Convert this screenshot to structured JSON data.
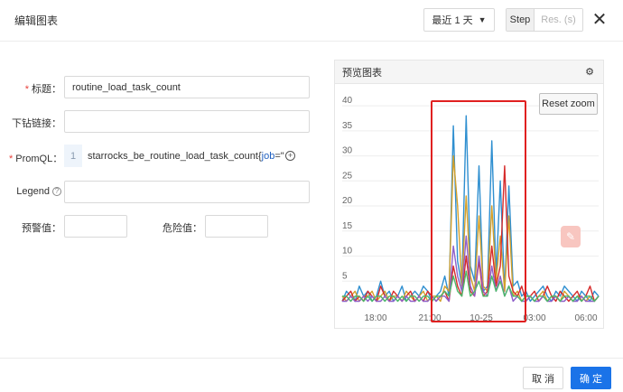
{
  "header": {
    "title": "编辑图表",
    "range_label": "最近 1 天",
    "step_label": "Step",
    "res_placeholder": "Res. (s)",
    "close_glyph": "✕"
  },
  "form": {
    "title_label": "标题：",
    "title_value": "routine_load_task_count",
    "drilldown_label": "下钻链接：",
    "drilldown_value": "",
    "promql_label": "PromQL：",
    "promql_line": "1",
    "promql_text": "starrocks_be_routine_load_task_count",
    "promql_brace": "{",
    "promql_key": "job",
    "promql_tail": "=\"",
    "legend_label": "Legend",
    "legend_value": "",
    "warn_label": "预警值：",
    "warn_value": "",
    "danger_label": "危险值：",
    "danger_value": ""
  },
  "preview": {
    "title": "预览图表",
    "reset_zoom": "Reset zoom"
  },
  "footer": {
    "cancel": "取 消",
    "ok": "确 定"
  },
  "icons": {
    "gear": "gear-icon",
    "help": "question-circle-icon",
    "add": "plus-circle-icon",
    "caret": "caret-down-icon",
    "float": "pencil-icon"
  },
  "colors": {
    "primary": "#1a73e8",
    "required": "#e8413a",
    "highlight": "#e02020"
  },
  "chart_data": {
    "type": "line",
    "x_ticks": [
      "18:00",
      "21:00",
      "10-25",
      "03:00",
      "06:00"
    ],
    "y_ticks": [
      5,
      10,
      15,
      20,
      25,
      30,
      35,
      40
    ],
    "ylim": [
      0,
      42
    ],
    "grid": true,
    "series": [
      {
        "color": "#2f8fd0",
        "values": [
          1,
          3,
          2,
          1,
          4,
          2,
          3,
          1,
          2,
          5,
          2,
          3,
          1,
          2,
          4,
          1,
          2,
          3,
          2,
          4,
          3,
          1,
          2,
          3,
          6,
          2,
          36,
          9,
          4,
          38,
          8,
          5,
          28,
          3,
          4,
          33,
          6,
          25,
          3,
          24,
          4,
          5,
          2,
          3,
          1,
          2,
          3,
          4,
          2,
          1,
          3,
          2,
          4,
          3,
          2,
          1,
          3,
          2,
          1,
          3,
          2
        ]
      },
      {
        "color": "#d4a02a",
        "values": [
          2,
          1,
          2,
          3,
          1,
          2,
          2,
          3,
          1,
          2,
          3,
          1,
          2,
          2,
          1,
          3,
          2,
          1,
          2,
          3,
          1,
          2,
          2,
          1,
          4,
          3,
          30,
          20,
          4,
          22,
          6,
          3,
          18,
          4,
          3,
          20,
          5,
          14,
          3,
          18,
          2,
          3,
          1,
          2,
          2,
          1,
          2,
          3,
          1,
          2,
          2,
          1,
          3,
          2,
          1,
          2,
          2,
          1,
          2,
          1,
          2
        ]
      },
      {
        "color": "#d62b2b",
        "values": [
          1,
          2,
          3,
          1,
          2,
          1,
          3,
          2,
          1,
          4,
          2,
          1,
          3,
          2,
          1,
          2,
          3,
          1,
          2,
          1,
          3,
          2,
          1,
          2,
          3,
          1,
          8,
          4,
          2,
          10,
          3,
          2,
          9,
          2,
          3,
          12,
          4,
          8,
          28,
          6,
          3,
          2,
          4,
          1,
          2,
          3,
          1,
          2,
          4,
          2,
          1,
          3,
          2,
          1,
          2,
          3,
          1,
          2,
          4,
          1,
          2
        ]
      },
      {
        "color": "#8e5fc9",
        "values": [
          1,
          1,
          2,
          1,
          1,
          2,
          1,
          2,
          1,
          1,
          2,
          1,
          1,
          2,
          1,
          2,
          1,
          1,
          2,
          1,
          1,
          2,
          1,
          2,
          2,
          1,
          12,
          6,
          3,
          14,
          4,
          2,
          10,
          3,
          2,
          8,
          3,
          6,
          2,
          4,
          1,
          2,
          1,
          1,
          2,
          1,
          1,
          2,
          1,
          1,
          2,
          1,
          1,
          2,
          1,
          1,
          2,
          1,
          1,
          1,
          2
        ]
      },
      {
        "color": "#4cb86a",
        "values": [
          2,
          2,
          1,
          2,
          2,
          1,
          2,
          1,
          2,
          2,
          1,
          2,
          2,
          1,
          2,
          1,
          2,
          2,
          1,
          2,
          2,
          1,
          2,
          2,
          3,
          2,
          6,
          3,
          2,
          7,
          2,
          3,
          5,
          2,
          2,
          6,
          3,
          5,
          2,
          4,
          2,
          2,
          1,
          2,
          2,
          1,
          2,
          2,
          1,
          2,
          2,
          1,
          2,
          2,
          1,
          2,
          1,
          2,
          2,
          1,
          2
        ]
      }
    ]
  }
}
